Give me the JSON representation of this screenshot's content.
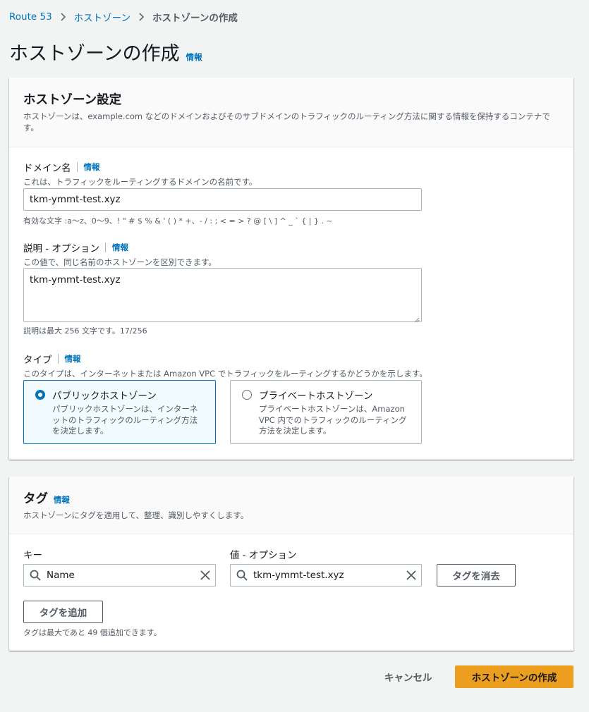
{
  "breadcrumb": {
    "items": [
      "Route 53",
      "ホストゾーン"
    ],
    "current": "ホストゾーンの作成"
  },
  "page": {
    "title": "ホストゾーンの作成",
    "info": "情報"
  },
  "hosted_zone_panel": {
    "title": "ホストゾーン設定",
    "description": "ホストゾーンは、example.com などのドメインおよびそのサブドメインのトラフィックのルーティング方法に関する情報を保持するコンテナです。",
    "domain": {
      "label": "ドメイン名",
      "info": "情報",
      "description": "これは、トラフィックをルーティングするドメインの名前です。",
      "value": "tkm-ymmt-test.xyz",
      "hint": "有効な文字 :a〜z、0〜9、! \" # $ % & ' ( ) * +、- / : ; < = > ? @ [ \\ ] ^ _ ` { | } . ~"
    },
    "comment": {
      "label": "説明 - オプション",
      "info": "情報",
      "description": "この値で、同じ名前のホストゾーンを区別できます。",
      "value": "tkm-ymmt-test.xyz",
      "hint": "説明は最大 256 文字です。17/256"
    },
    "type": {
      "label": "タイプ",
      "info": "情報",
      "description": "このタイプは、インターネットまたは Amazon VPC でトラフィックをルーティングするかどうかを示します。",
      "options": [
        {
          "title": "パブリックホストゾーン",
          "desc": "パブリックホストゾーンは、インターネットのトラフィックのルーティング方法を決定します。",
          "selected": true
        },
        {
          "title": "プライベートホストゾーン",
          "desc": "プライベートホストゾーンは、Amazon VPC 内でのトラフィックのルーティング方法を決定します。",
          "selected": false
        }
      ]
    }
  },
  "tags_panel": {
    "title": "タグ",
    "info": "情報",
    "description": "ホストゾーンにタグを適用して、整理、識別しやすくします。",
    "key_label": "キー",
    "value_label": "値 - オプション",
    "key_value": "Name",
    "value_value": "tkm-ymmt-test.xyz",
    "remove_tag": "タグを消去",
    "add_tag": "タグを追加",
    "hint": "タグは最大であと 49 個追加できます。"
  },
  "footer": {
    "cancel": "キャンセル",
    "create": "ホストゾーンの作成"
  },
  "colors": {
    "link": "#0073bb",
    "primary": "#ec9f1e",
    "background": "#f2f3f3"
  }
}
